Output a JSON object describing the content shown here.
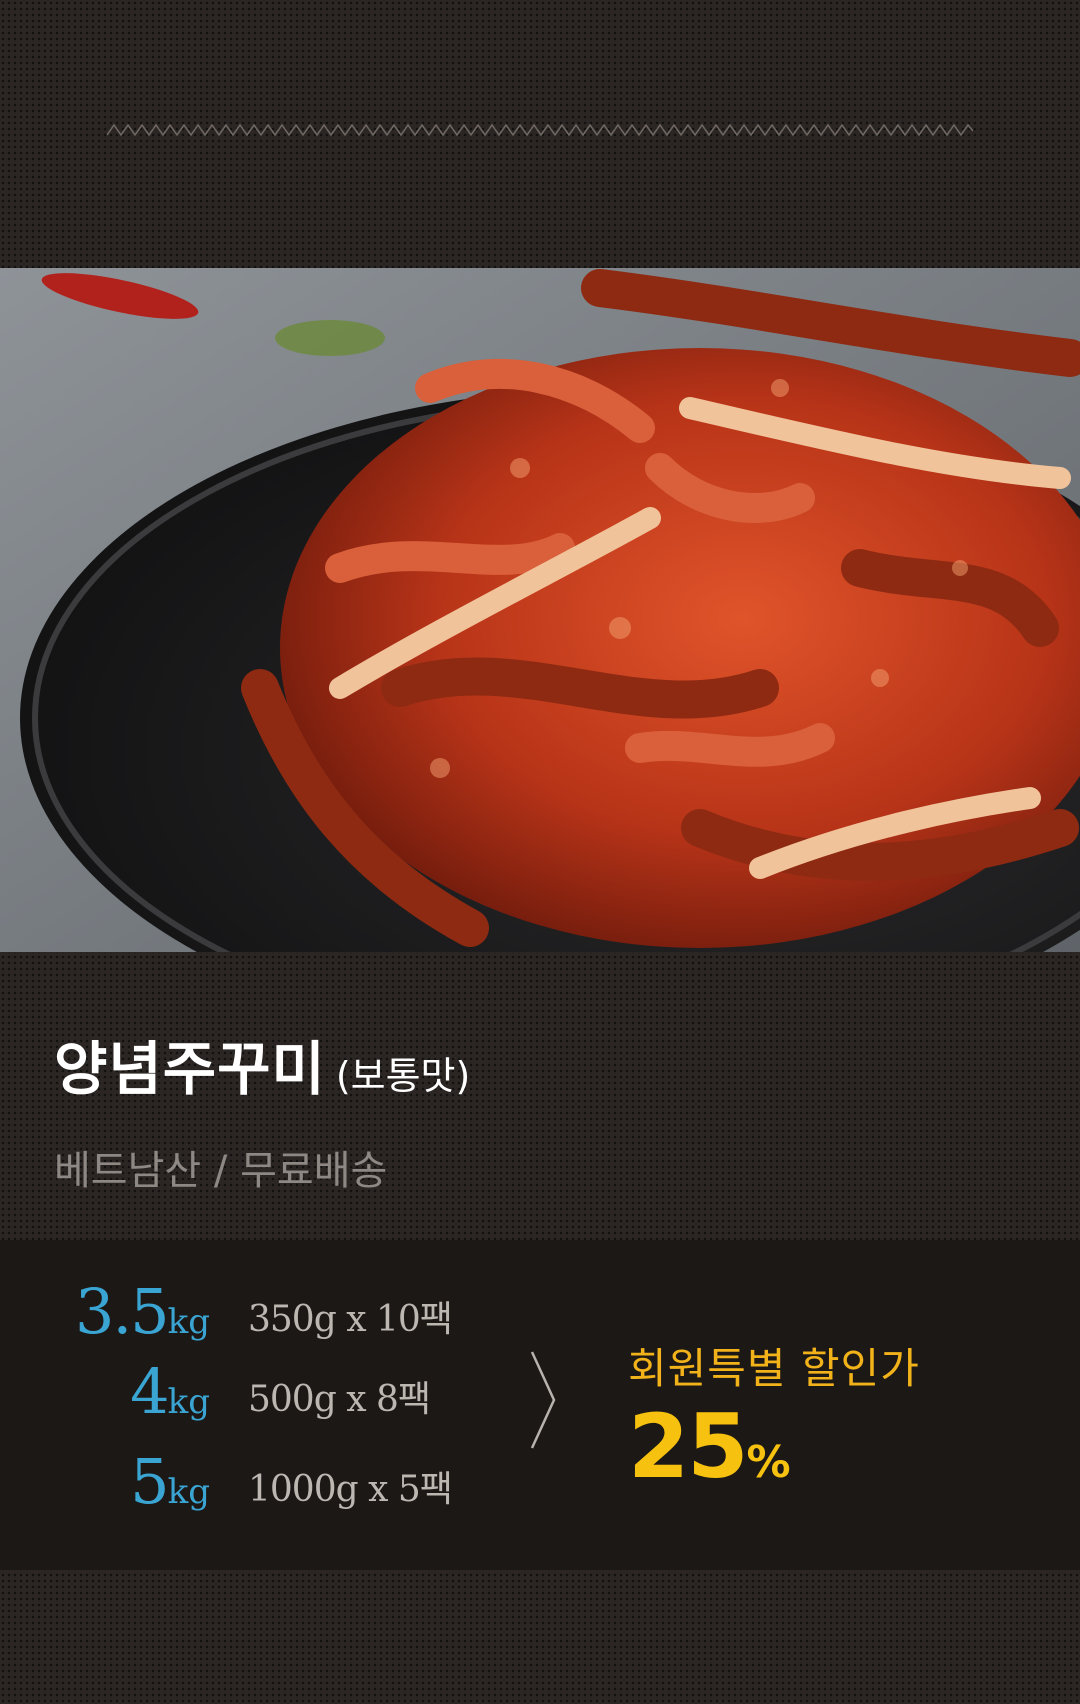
{
  "product": {
    "name": "양념주꾸미",
    "variant": "(보통맛)",
    "origin_shipping": "베트남산 / 무료배송"
  },
  "options": [
    {
      "weight": "3.5",
      "unit": "kg",
      "pack": "350g x 10팩"
    },
    {
      "weight": "4",
      "unit": "kg",
      "pack": "500g x 8팩"
    },
    {
      "weight": "5",
      "unit": "kg",
      "pack": "1000g x 5팩"
    }
  ],
  "discount": {
    "label": "회원특별 할인가",
    "value": "25",
    "unit": "%"
  },
  "colors": {
    "background": "#2b2624",
    "band": "#1c1816",
    "weight_accent": "#3aa5d3",
    "discount_accent": "#f6c10f"
  },
  "icons": {
    "divider": "zigzag-divider",
    "arrow": "chevron-right-icon"
  }
}
